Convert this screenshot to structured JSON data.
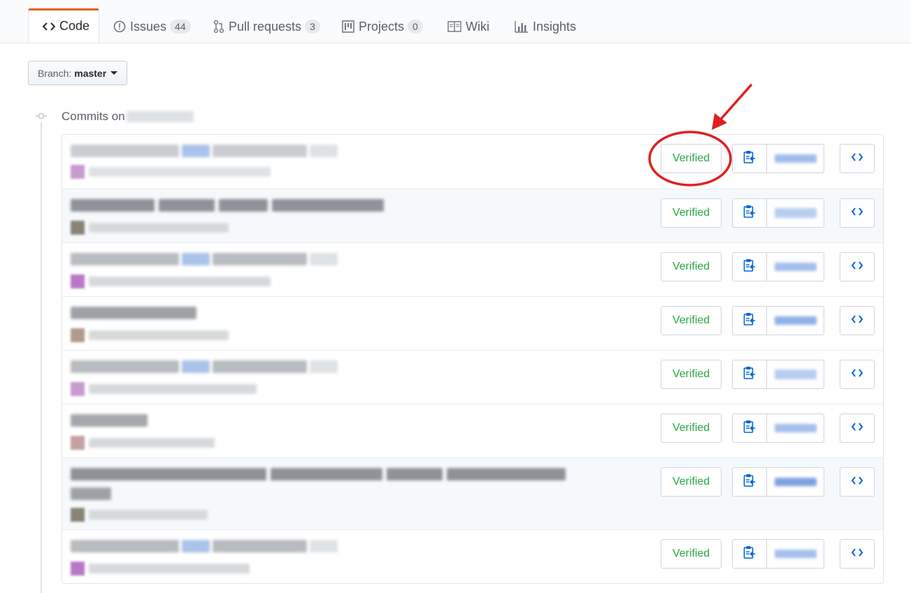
{
  "tabs": {
    "code": {
      "label": "Code",
      "icon": "code-icon"
    },
    "issues": {
      "label": "Issues",
      "count": "44",
      "icon": "issue-opened-icon"
    },
    "pulls": {
      "label": "Pull requests",
      "count": "3",
      "icon": "git-pull-request-icon"
    },
    "projects": {
      "label": "Projects",
      "count": "0",
      "icon": "project-icon"
    },
    "wiki": {
      "label": "Wiki",
      "icon": "book-icon"
    },
    "insights": {
      "label": "Insights",
      "icon": "graph-icon"
    }
  },
  "branch": {
    "prefix": "Branch:",
    "name": "master"
  },
  "commits_heading": "Commits on",
  "commits": [
    {
      "verified_label": "Verified"
    },
    {
      "verified_label": "Verified"
    },
    {
      "verified_label": "Verified"
    },
    {
      "verified_label": "Verified"
    },
    {
      "verified_label": "Verified"
    },
    {
      "verified_label": "Verified"
    },
    {
      "verified_label": "Verified"
    },
    {
      "verified_label": "Verified"
    }
  ],
  "colors": {
    "accent_tab": "#e36209",
    "verified_text": "#28a745",
    "link_blue": "#0366d6",
    "annotation_red": "#e02020"
  }
}
